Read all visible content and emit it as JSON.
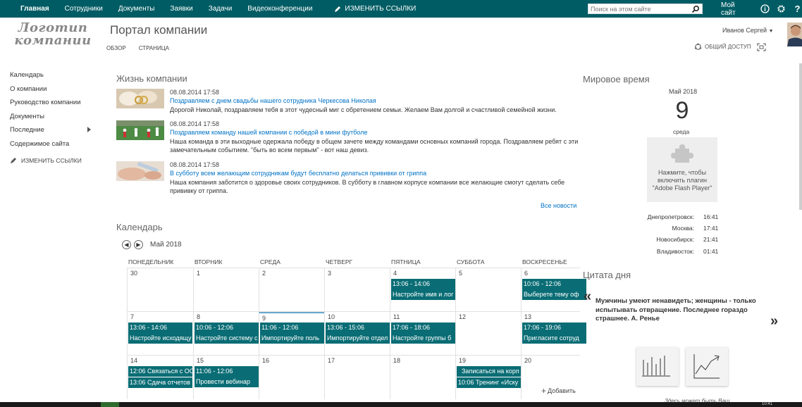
{
  "suitebar": {
    "nav": [
      "Главная",
      "Сотрудники",
      "Документы",
      "Заявки",
      "Задачи",
      "Видеоконференции"
    ],
    "edit_links": "ИЗМЕНИТЬ ССЫЛКИ",
    "search_placeholder": "Поиск на этом сайте",
    "my_site": "Мой сайт",
    "icons": [
      "info-icon",
      "gear-icon",
      "help-icon"
    ]
  },
  "header": {
    "logo_line1": "Логотип",
    "logo_line2": "компании",
    "title": "Портал компании",
    "tabs": [
      "ОБЗОР",
      "СТРАНИЦА"
    ],
    "user": "Иванов Сергей",
    "share": "ОБЩИЙ ДОСТУП"
  },
  "left_nav": {
    "items": [
      "Календарь",
      "О компании",
      "Руководство компании",
      "Документы",
      "Последние",
      "Содержимое сайта"
    ],
    "edit": "ИЗМЕНИТЬ ССЫЛКИ"
  },
  "news": {
    "heading": "Жизнь компании",
    "items": [
      {
        "date": "08.08.2014 17:58",
        "title": "Поздравляем с днем свадьбы нашего сотрудника Черкесова Николая",
        "text": "Дорогой Николай, поздравляем тебя в этот чудесный миг с обретением семьи. Желаем Вам долгой и счастливой семейной жизни."
      },
      {
        "date": "08.08.2014 17:58",
        "title": "Поздравляем команду нашей компании с победой в мини футболе",
        "text": "Наша команда в эти выходные одержала победу в общем зачете между командами основных компаний города. Поздравляем ребят с эти замечательным событием. \"быть во всем первым\" - вот наш девиз."
      },
      {
        "date": "08.08.2014 17:58",
        "title": "В субботу всем желающим сотрудникам будут бесплатно делаться прививки от гриппа",
        "text": "Наша компания заботится о здоровье своих сотрудников. В субботу в главном корпусе компании все желающие смогут сделать себе прививку от гриппа."
      }
    ],
    "all_news": "Все новости"
  },
  "calendar": {
    "heading": "Календарь",
    "month": "Май 2018",
    "days": [
      "ПОНЕДЕЛЬНИК",
      "ВТОРНИК",
      "СРЕДА",
      "ЧЕТВЕРГ",
      "ПЯТНИЦА",
      "СУББОТА",
      "ВОСКРЕСЕНЬЕ"
    ],
    "weeks": [
      {
        "nums": [
          "30",
          "1",
          "2",
          "3",
          "4",
          "5",
          "6"
        ],
        "events": [
          {
            "day": 4,
            "time": "13:06 - 14:06",
            "title": "Настройте имя и лог"
          },
          {
            "day": 6,
            "time": "10:06 - 12:06",
            "title": "Выберете тему оф"
          }
        ]
      },
      {
        "nums": [
          "7",
          "8",
          "9",
          "10",
          "11",
          "12",
          "13"
        ],
        "events": [
          {
            "day": 0,
            "time": "13:06 - 14:06",
            "title": "Настройте исходящу"
          },
          {
            "day": 1,
            "time": "10:06 - 12:06",
            "title": "Настройте систему с"
          },
          {
            "day": 2,
            "time": "11:06 - 12:06",
            "title": "Импортируйте поль"
          },
          {
            "day": 3,
            "time": "13:06 - 15:06",
            "title": "Импортируйте отдел"
          },
          {
            "day": 4,
            "time": "17:06 - 18:06",
            "title": "Настройте группы б"
          },
          {
            "day": 6,
            "time": "17:06 - 19:06",
            "title": "Пригласите сотруд"
          }
        ]
      },
      {
        "nums": [
          "14",
          "15",
          "16",
          "17",
          "18",
          "19",
          "20"
        ],
        "events": [
          {
            "day": 0,
            "single": "12:06 Связаться с ОО",
            "row": 0
          },
          {
            "day": 0,
            "single": "13:06 Сдача отчетов",
            "row": 1
          },
          {
            "day": 1,
            "time": "11:06 - 12:06",
            "title": "Провести вебинар"
          },
          {
            "day": 5,
            "single": "Записаться на корп",
            "row": 0
          },
          {
            "day": 5,
            "single": "10:06 Тренинг «Иску",
            "row": 1
          }
        ]
      }
    ],
    "add": "Добавить"
  },
  "world_time": {
    "heading": "Мировое время",
    "month": "Май 2018",
    "day": "9",
    "weekday": "среда",
    "flash_msg": "Нажмите, чтобы включить плагин \"Adobe Flash Player\"",
    "cities": [
      {
        "city": "Днепропетровск:",
        "time": "16:41"
      },
      {
        "city": "Москва:",
        "time": "17:41"
      },
      {
        "city": "Новосибирск:",
        "time": "21:41"
      },
      {
        "city": "Владивосток:",
        "time": "01:41"
      }
    ]
  },
  "quote": {
    "heading": "Цитата дня",
    "text": "Мужчины умеют ненавидеть; женщины - только испытывать отвращение. Последнее гораздо страшнее. А. Ренье",
    "teaser": "Здесь может быть Ваш"
  },
  "taskbar": {
    "clock": "10:41"
  },
  "colors": {
    "suitebar": "#005c64",
    "event": "#0a6d75",
    "link": "#0072c6"
  }
}
